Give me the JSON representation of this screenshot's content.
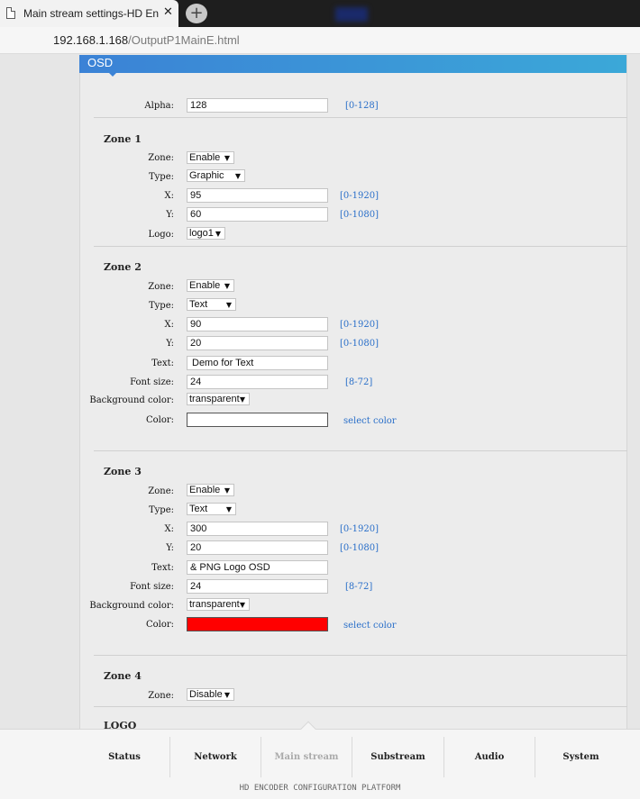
{
  "browser": {
    "tab_title": "Main stream settings-HD Encode",
    "close_glyph": "✕",
    "newtab_glyph": "+",
    "url_host": "192.168.1.168",
    "url_path": "/OutputP1MainE.html"
  },
  "osd": {
    "header": "OSD",
    "alpha_label": "Alpha:",
    "alpha_value": "128",
    "alpha_range": "[0-128]"
  },
  "zone1": {
    "title": "Zone 1",
    "zone_label": "Zone:",
    "zone_value": "Enable",
    "type_label": "Type:",
    "type_value": "Graphic",
    "x_label": "X:",
    "x_value": "95",
    "x_range": "[0-1920]",
    "y_label": "Y:",
    "y_value": "60",
    "y_range": "[0-1080]",
    "logo_label": "Logo:",
    "logo_value": "logo1"
  },
  "zone2": {
    "title": "Zone 2",
    "zone_label": "Zone:",
    "zone_value": "Enable",
    "type_label": "Type:",
    "type_value": "Text",
    "x_label": "X:",
    "x_value": "90",
    "x_range": "[0-1920]",
    "y_label": "Y:",
    "y_value": "20",
    "y_range": "[0-1080]",
    "text_label": "Text:",
    "text_value": "Demo for Text",
    "fontsize_label": "Font size:",
    "fontsize_value": "24",
    "fontsize_range": "[8-72]",
    "bg_label": "Background color:",
    "bg_value": "transparent",
    "color_label": "Color:",
    "color_value": "#ffffff",
    "select_color": "select color"
  },
  "zone3": {
    "title": "Zone 3",
    "zone_label": "Zone:",
    "zone_value": "Enable",
    "type_label": "Type:",
    "type_value": "Text",
    "x_label": "X:",
    "x_value": "300",
    "x_range": "[0-1920]",
    "y_label": "Y:",
    "y_value": "20",
    "y_range": "[0-1080]",
    "text_label": "Text:",
    "text_value": "& PNG Logo OSD",
    "fontsize_label": "Font size:",
    "fontsize_value": "24",
    "fontsize_range": "[8-72]",
    "bg_label": "Background color:",
    "bg_value": "transparent",
    "color_label": "Color:",
    "color_value": "#ff0000",
    "select_color": "select color"
  },
  "zone4": {
    "title": "Zone 4",
    "zone_label": "Zone:",
    "zone_value": "Disable"
  },
  "logo_section": "LOGO",
  "nav": {
    "items": [
      "Status",
      "Network",
      "Main stream",
      "Substream",
      "Audio",
      "System"
    ],
    "active": "Main stream",
    "platform": "HD ENCODER CONFIGURATION PLATFORM"
  },
  "colors": {
    "accent": "#3b82d6",
    "range_text": "#2a6fc9"
  }
}
